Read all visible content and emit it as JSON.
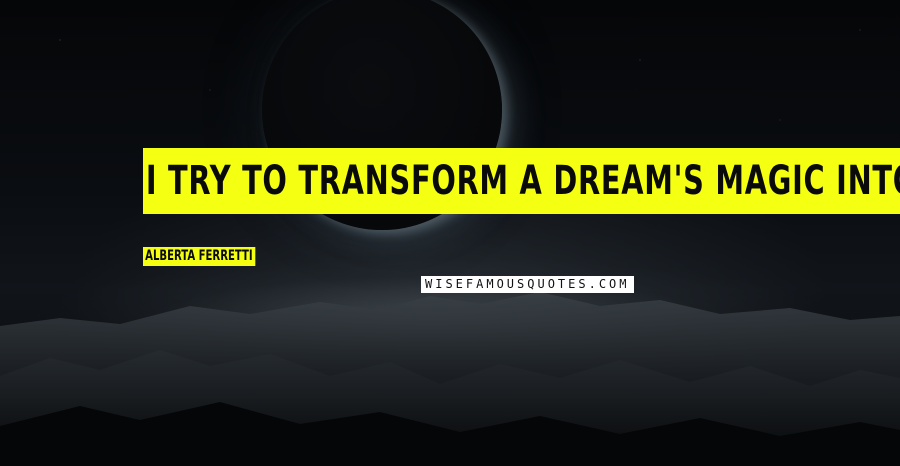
{
  "quote": {
    "text": "I TRY TO TRANSFORM A DREAM'S MAGIC INTO REALITY.",
    "author": "ALBERTA FERRETTI",
    "highlight_color": "#f4ff12"
  },
  "watermark": {
    "text": "WISEFAMOUSQUOTES.COM"
  },
  "background": {
    "description_colors": {
      "sky": "#07090c",
      "horizon": "#5f6970"
    }
  }
}
